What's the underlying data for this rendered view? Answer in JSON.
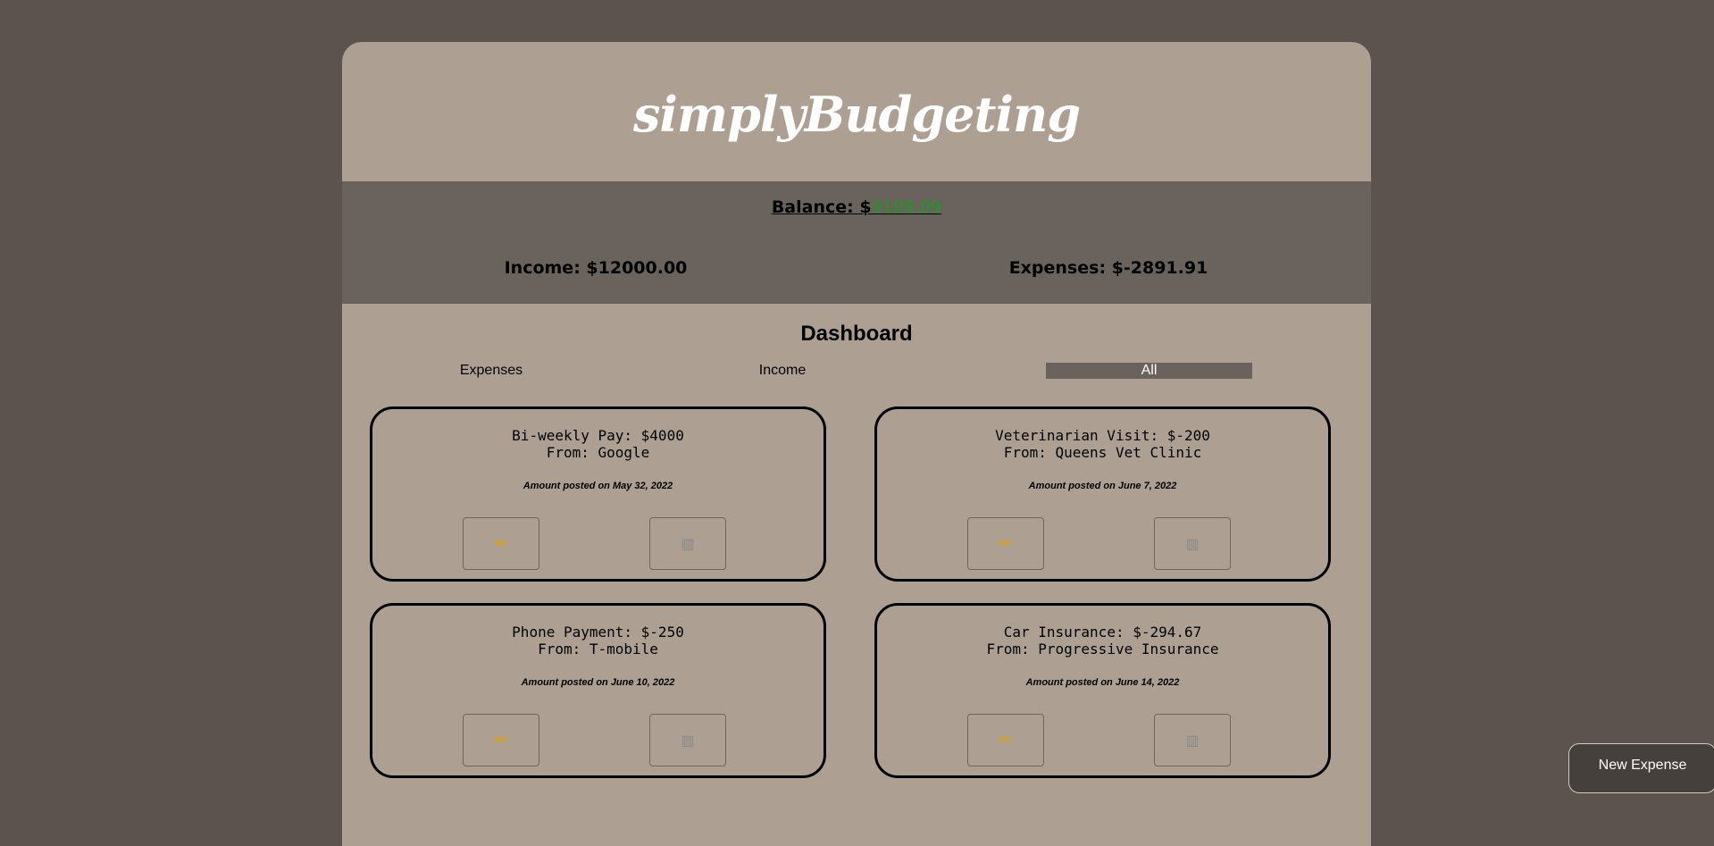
{
  "header": {
    "title": "simplyBudgeting"
  },
  "summary": {
    "balance_label": "Balance: $",
    "balance_value": "9108.09",
    "income": "Income: $12000.00",
    "expenses": "Expenses: $-2891.91"
  },
  "dashboard": {
    "title": "Dashboard",
    "tabs": {
      "expenses": "Expenses",
      "income": "Income",
      "all": "All"
    },
    "selected_tab": "All"
  },
  "cards": [
    {
      "line1": "Bi-weekly Pay: $4000",
      "line2": "From: Google",
      "date": "Amount posted on May 32, 2022"
    },
    {
      "line1": "Veterinarian Visit: $-200",
      "line2": "From: Queens Vet Clinic",
      "date": "Amount posted on June 7, 2022"
    },
    {
      "line1": "Phone Payment: $-250",
      "line2": "From: T-mobile",
      "date": "Amount posted on June 10, 2022"
    },
    {
      "line1": "Car Insurance: $-294.67",
      "line2": "From: Progressive Insurance",
      "date": "Amount posted on June 14, 2022"
    }
  ],
  "icons": {
    "edit": "pencil-icon",
    "delete": "trash-icon"
  },
  "actions": {
    "new_expense": "New Expense"
  },
  "colors": {
    "background": "#5c524e",
    "panel": "#ada093",
    "summary": "#6a625c",
    "balance_value": "#1f9a1f"
  }
}
